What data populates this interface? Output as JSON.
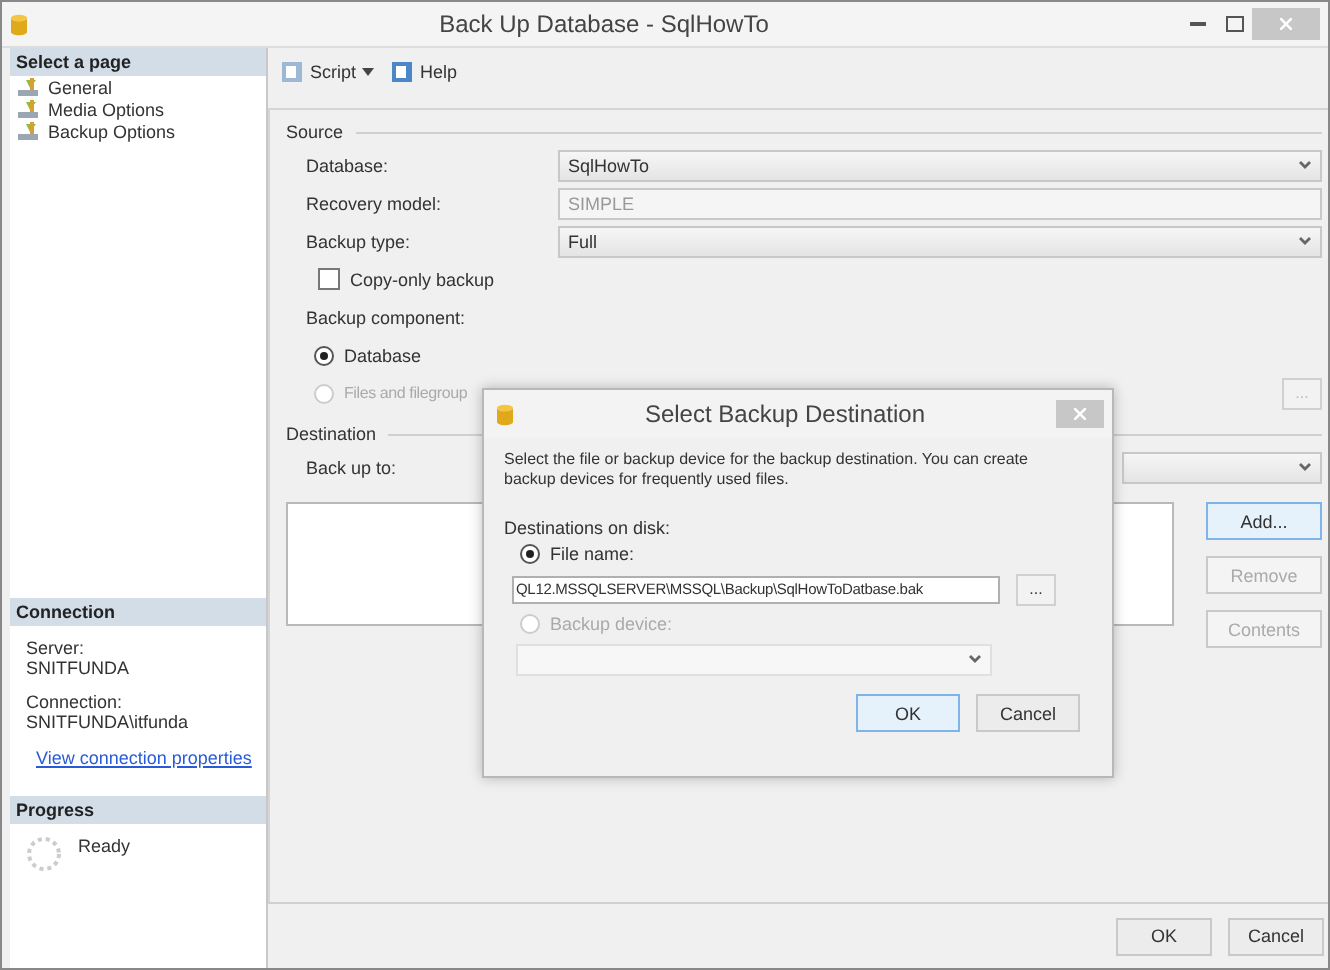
{
  "window": {
    "title": "Back Up Database - SqlHowTo"
  },
  "sidebar": {
    "header": "Select a page",
    "pages": [
      "General",
      "Media Options",
      "Backup Options"
    ]
  },
  "connection": {
    "header": "Connection",
    "server_label": "Server:",
    "server": "SNITFUNDA",
    "connection_label": "Connection:",
    "connection": "SNITFUNDA\\itfunda",
    "link": "View connection properties"
  },
  "progress": {
    "header": "Progress",
    "status": "Ready"
  },
  "toolbar": [
    {
      "label": "Script",
      "dropdown": true
    },
    {
      "label": "Help",
      "dropdown": false
    }
  ],
  "source": {
    "title": "Source",
    "fields": [
      {
        "label": "Database:",
        "value": "SqlHowTo",
        "kind": "dropdown"
      },
      {
        "label": "Recovery model:",
        "value": "SIMPLE",
        "kind": "readonly"
      },
      {
        "label": "Backup type:",
        "value": "Full",
        "kind": "dropdown"
      }
    ],
    "copy_only": {
      "label": "Copy-only backup",
      "checked": false
    },
    "component_label": "Backup component:",
    "components": [
      {
        "label": "Database",
        "selected": true,
        "disabled": false
      },
      {
        "label": "Files and filegroup",
        "selected": false,
        "disabled": true
      }
    ],
    "files_browse": "..."
  },
  "destination": {
    "title": "Destination",
    "back_up_to_label": "Back up to:",
    "buttons": [
      {
        "label": "Add...",
        "disabled": false
      },
      {
        "label": "Remove",
        "disabled": true
      },
      {
        "label": "Contents",
        "disabled": true
      }
    ]
  },
  "buttons": [
    "OK",
    "Cancel"
  ],
  "dialog": {
    "title": "Select Backup Destination",
    "description": "Select the file or backup device for the backup destination. You can create backup devices for frequently used files.",
    "group_label": "Destinations on disk:",
    "options": [
      {
        "label": "File name:",
        "selected": true,
        "disabled": false
      },
      {
        "label": "Backup device:",
        "selected": false,
        "disabled": true
      }
    ],
    "file_name": "QL12.MSSQLSERVER\\MSSQL\\Backup\\SqlHowToDatbase.bak",
    "browse": "...",
    "buttons": [
      "OK",
      "Cancel"
    ]
  }
}
